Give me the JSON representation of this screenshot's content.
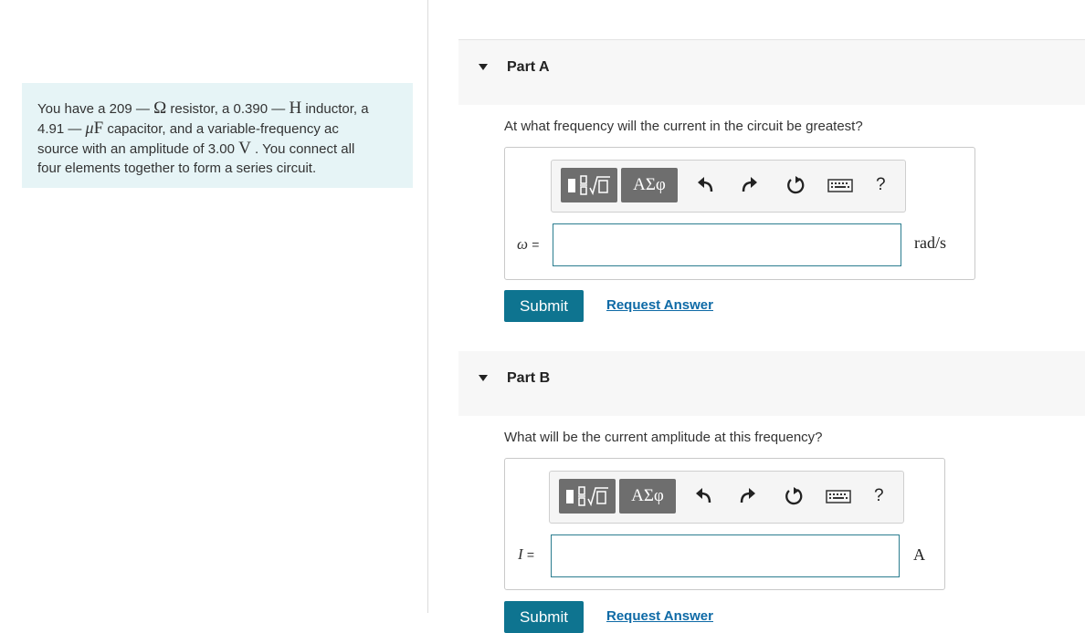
{
  "problem": {
    "seg1": "You have a 209",
    "ohm": "Ω",
    "seg2": "resistor, a 0.390",
    "henry": "H",
    "seg3": "inductor, a",
    "seg4": "4.91",
    "micro": "μ",
    "farad": "F",
    "seg5": "capacitor, and a variable-frequency ac",
    "seg6": "source with an amplitude of 3.00",
    "volt": "V",
    "seg7": ". You connect all",
    "seg8": "four elements together to form a series circuit.",
    "dash": "—"
  },
  "parts": [
    {
      "title": "Part A",
      "question": "At what frequency will the current in the circuit be greatest?",
      "variable": "ω",
      "equals": "=",
      "input_value": "",
      "unit": "rad/s",
      "submit_label": "Submit",
      "request_label": "Request Answer"
    },
    {
      "title": "Part B",
      "question": "What will be the current amplitude at this frequency?",
      "variable": "I",
      "equals": "=",
      "input_value": "",
      "unit": "A",
      "submit_label": "Submit",
      "request_label": "Request Answer"
    }
  ],
  "toolbar": {
    "greek_label": "ΑΣφ",
    "help_label": "?"
  },
  "icons": [
    "templates-icon",
    "greek-letters-icon",
    "undo-icon",
    "redo-icon",
    "reset-icon",
    "keyboard-icon",
    "help-icon",
    "collapse-triangle-icon"
  ],
  "colors": {
    "accent": "#0e7490",
    "link": "#0e6aa6",
    "problem_bg": "#e6f4f6"
  }
}
